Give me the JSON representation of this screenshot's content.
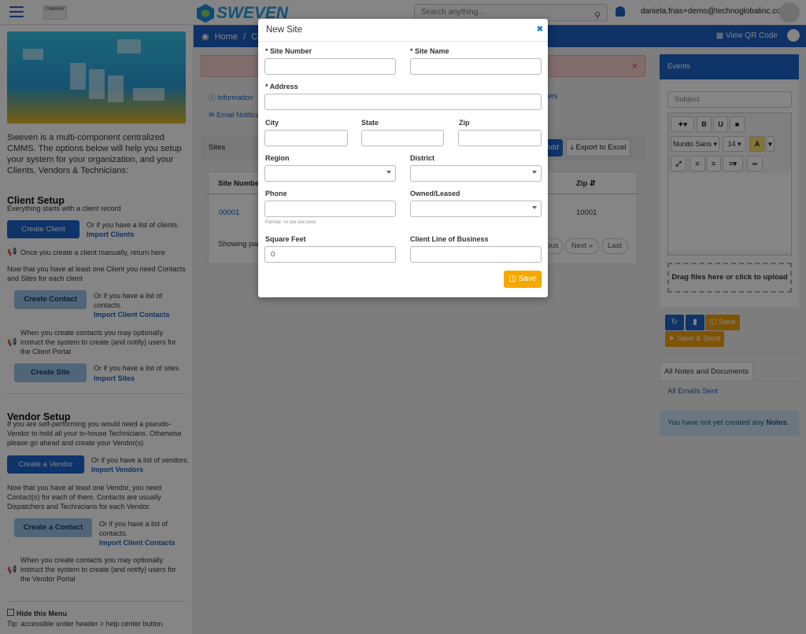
{
  "header": {
    "brand": "SWEVEN",
    "company_logo_text": "COMPANY",
    "search_placeholder": "Search anything...",
    "user_email": "daniela.frias+demo@technoglobalinc.com"
  },
  "sidebar": {
    "intro": "Sweven is a multi-component centralized CMMS. The options below will help you setup your system for your organization, and your Clients, Vendors & Technicians:",
    "client_setup": {
      "title": "Client Setup",
      "desc": "Everything starts with a client record",
      "create_client": "Create Client",
      "list_note": "Or if you have a list of clients.",
      "import_clients": "Import Clients",
      "return_note": "Once you create a client manually, return here",
      "contacts_note": "Now that you have at least one Client you need Contacts and Sites for  each client",
      "create_contact": "Create Contact",
      "contacts_list_note": "Or if you have a list of contacts.",
      "import_client_contacts": "Import Client Contacts",
      "users_note": "When you create contacts you may optionally instruct the system to create (and notify) users for the Client Portal",
      "create_site": "Create Site",
      "sites_list_note": "Or if you have a list of sites.",
      "import_sites": "Import Sites"
    },
    "vendor_setup": {
      "title": "Vendor Setup",
      "desc": "If you are self-performing you would need a pseudo-Vendor to hold all your in-house Technicians. Otherwise please go ahead and create your Vendor(s)",
      "create_vendor": "Create a Vendor",
      "list_note": "Or if you have a list of vendors.",
      "import_vendors": "Import Vendors",
      "contacts_note": "Now that you have at least one Vendor, you need Contact(s) for each of them. Contacts are usually Dispatchers and Technicians for each Vendor.",
      "create_contact": "Create a Contact",
      "contacts_list_note": "Or if you have a list of contacts.",
      "import_client_contacts": "Import Client Contacts",
      "users_note": "When you create contacts you may optionally instruct the system to create (and notify) users for the Vendor Portal"
    },
    "hide_menu": "Hide this Menu",
    "tip": "Tip: accessible under header > help center button"
  },
  "main": {
    "crumb_home": "Home",
    "crumb_sep": "/",
    "crumb_next": "Cli",
    "view_qr": "View QR Code",
    "tab_information": "Information",
    "tab_email": "Email Notifica",
    "tab_right": "ers",
    "sites_label": "Sites",
    "add_btn": "Add",
    "export_btn": "Export to Excel",
    "col_site_number": "Site Number",
    "col_zip": "Zip",
    "row_site_number": "00001",
    "row_zip": "10001",
    "showing": "Showing pag",
    "prev": "ous",
    "next": "Next »",
    "last": "Last"
  },
  "right_panel": {
    "events": "Events",
    "subject_placeholder": "Subject",
    "font_name": "Nunito Sans",
    "font_size": "14",
    "bold": "B",
    "underline": "U",
    "dropzone": "Drag files here or click to upload",
    "save": "Save",
    "save_send": "Save & Send",
    "notes_tab": "All Notes and Documents",
    "emails_tab": "All Emails Sent",
    "no_notes_prefix": "You have not yet created any ",
    "no_notes_bold": "Notes",
    "no_notes_suffix": "."
  },
  "modal": {
    "title": "New Site",
    "site_number_label": "* Site Number",
    "site_name_label": "* Site Name",
    "address_label": "* Address",
    "city_label": "City",
    "state_label": "State",
    "zip_label": "Zip",
    "region_label": "Region",
    "district_label": "District",
    "phone_label": "Phone",
    "phone_hint": "Format: +x xxx xxx xxxx",
    "owned_label": "Owned/Leased",
    "square_feet_label": "Square Feet",
    "square_feet_value": "0",
    "line_of_business_label": "Client Line of Business",
    "save_button": "Save"
  },
  "colors": {
    "primary": "#1b64c9",
    "accent": "#f6a800",
    "overlay": "rgba(0,0,0,0.48)"
  }
}
